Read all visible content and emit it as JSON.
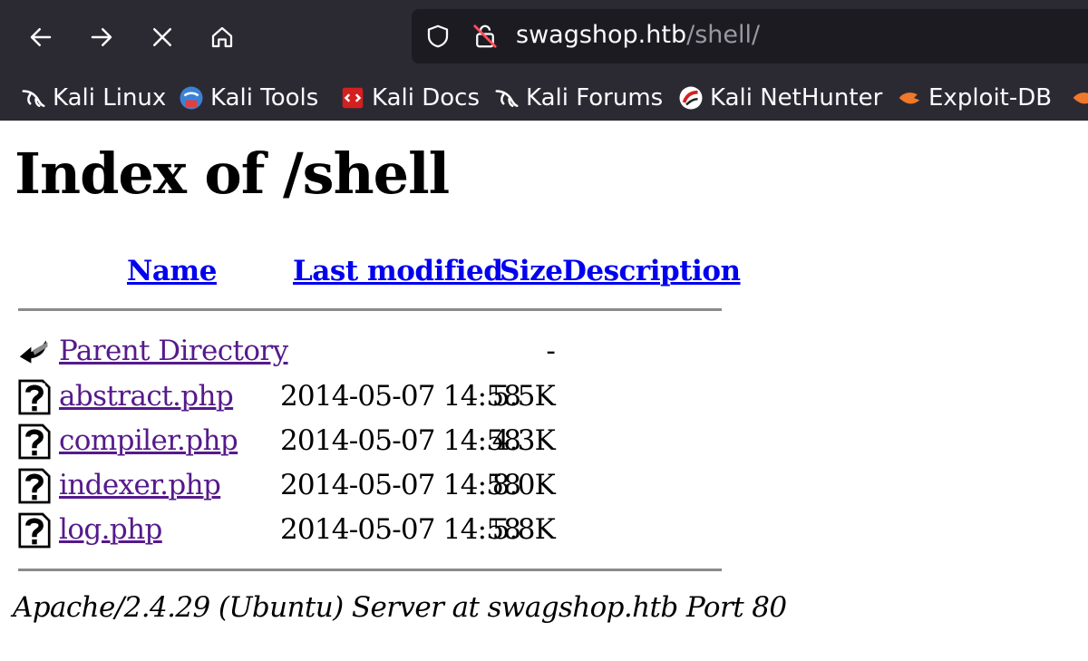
{
  "browser": {
    "url_host": "swagshop.htb",
    "url_path": "/shell/",
    "bookmarks": [
      {
        "label": "Kali Linux",
        "icon": "kali-dragon-icon"
      },
      {
        "label": "Kali Tools",
        "icon": "kali-tools-icon"
      },
      {
        "label": "Kali Docs",
        "icon": "kali-docs-icon"
      },
      {
        "label": "Kali Forums",
        "icon": "kali-dragon-icon"
      },
      {
        "label": "Kali NetHunter",
        "icon": "nethunter-icon"
      },
      {
        "label": "Exploit-DB",
        "icon": "exploit-db-icon"
      }
    ],
    "colors": {
      "chrome_bg": "#2b2a33",
      "urlbar_bg": "#1c1b22",
      "text": "#fbfbfe",
      "path_text": "#9a99a3"
    }
  },
  "page": {
    "title": "Index of /shell",
    "columns": {
      "name": "Name",
      "last_modified": "Last modified",
      "size": "Size",
      "description": "Description"
    },
    "rows": [
      {
        "name": "Parent Directory",
        "date": "",
        "size": "-",
        "icon": "back-arrow-icon"
      },
      {
        "name": "abstract.php",
        "date": "2014-05-07 14:58",
        "size": "5.5K",
        "icon": "unknown-file-icon"
      },
      {
        "name": "compiler.php",
        "date": "2014-05-07 14:58",
        "size": "4.3K",
        "icon": "unknown-file-icon"
      },
      {
        "name": "indexer.php",
        "date": "2014-05-07 14:58",
        "size": "8.0K",
        "icon": "unknown-file-icon"
      },
      {
        "name": "log.php",
        "date": "2014-05-07 14:58",
        "size": "5.8K",
        "icon": "unknown-file-icon"
      }
    ],
    "footer": "Apache/2.4.29 (Ubuntu) Server at swagshop.htb Port 80",
    "colors": {
      "link": "#0000ee",
      "visited": "#551a8b"
    }
  }
}
